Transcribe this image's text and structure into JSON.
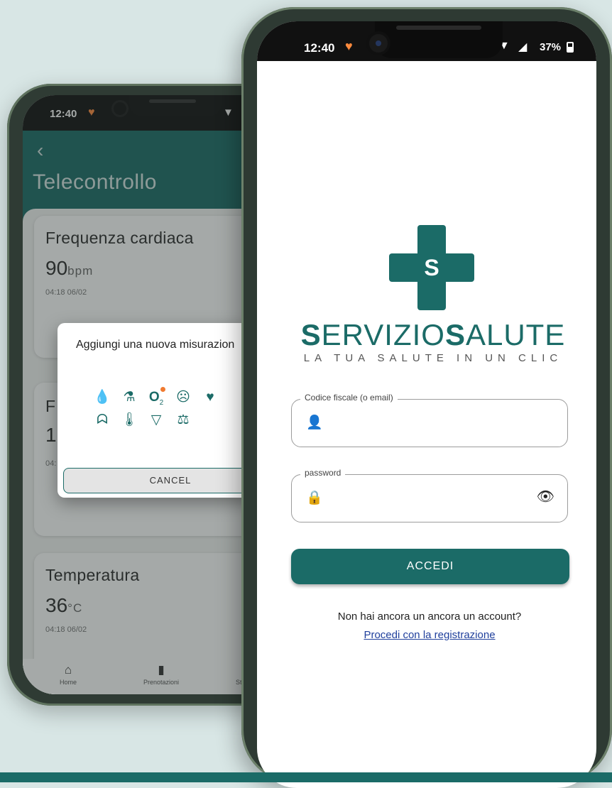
{
  "back_phone": {
    "status": {
      "time": "12:40"
    },
    "header": {
      "back": "‹",
      "title": "Telecontrollo"
    },
    "cards": [
      {
        "title": "Frequenza cardiaca",
        "value": "90",
        "unit": "bpm",
        "date": "04:18 06/02"
      },
      {
        "title_partial": "F",
        "value_partial": "1(",
        "date_partial": "04:"
      },
      {
        "title": "Temperatura",
        "value": "36",
        "unit": "°C",
        "date": "04:18 06/02"
      }
    ],
    "nav": [
      {
        "label": "Home",
        "icon": "home-icon"
      },
      {
        "label": "Prenotazioni",
        "icon": "bookmark-icon"
      },
      {
        "label": "Sta",
        "icon": "stats-icon"
      }
    ],
    "dialog": {
      "title": "Aggiungi una nuova misurazion",
      "icons": [
        "glucose-drop-icon",
        "insulin-syringe-icon",
        "oxygen-saturation-icon",
        "mood-sad-icon",
        "heart-icon",
        "lungs-icon",
        "thermometer-icon",
        "urine-cup-icon",
        "weight-scale-icon"
      ],
      "cancel_label": "CANCEL"
    }
  },
  "front_phone": {
    "status": {
      "time": "12:40",
      "battery": "37%"
    },
    "brand": {
      "first_S": "S",
      "first_rest": "ERVIZIO",
      "second_S": "S",
      "second_rest": "ALUTE",
      "tagline": "LA TUA SALUTE IN UN CLIC"
    },
    "login": {
      "user_label": "Codice fiscale (o email)",
      "user_value": "",
      "password_label": "password",
      "password_value": "",
      "submit_label": "ACCEDI",
      "no_account_text": "Non hai ancora un ancora un account?",
      "register_link": "Procedi con la registrazione"
    },
    "colors": {
      "primary": "#1b6b67",
      "link": "#1f3f9c",
      "accent": "#f07a30"
    }
  }
}
